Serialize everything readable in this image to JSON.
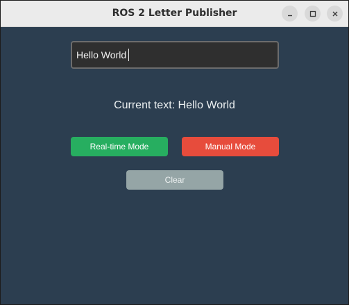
{
  "window": {
    "title": "ROS 2 Letter Publisher",
    "controls": [
      "minimize-icon",
      "maximize-icon",
      "close-icon"
    ]
  },
  "input": {
    "value": "Hello World"
  },
  "status": {
    "current_text": "Current text: Hello World"
  },
  "buttons": {
    "realtime_label": "Real-time Mode",
    "manual_label": "Manual Mode",
    "clear_label": "Clear"
  },
  "colors": {
    "background": "#2c3e50",
    "realtime": "#27ae60",
    "manual": "#e74c3c",
    "clear": "#95a5a6"
  }
}
